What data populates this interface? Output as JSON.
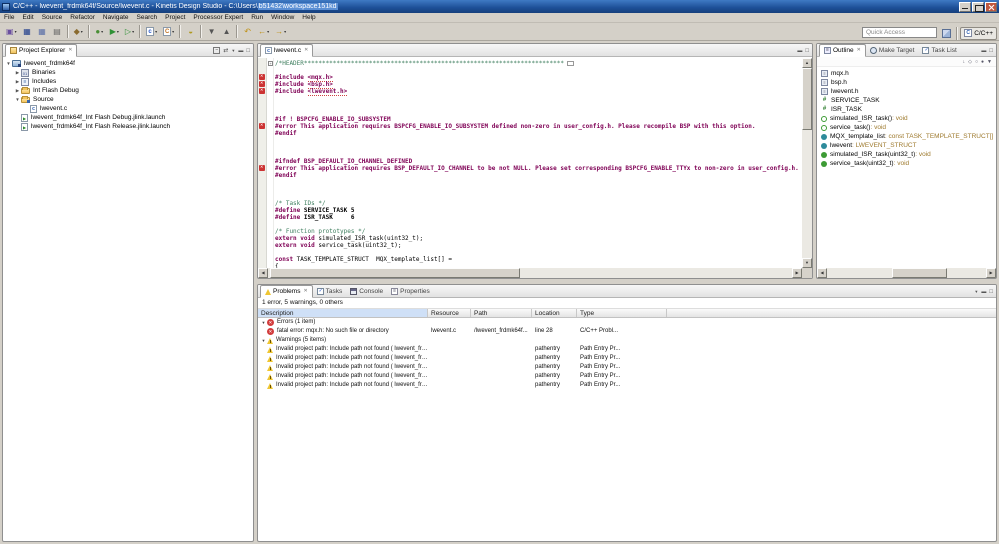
{
  "window": {
    "title_prefix": "C/C++ - lwevent_frdmk64f/Source/lwevent.c - Kinetis Design Studio - C:\\Users\\",
    "title_highlight": "b51432\\workspace151kd"
  },
  "menu": {
    "items": [
      "File",
      "Edit",
      "Source",
      "Refactor",
      "Navigate",
      "Search",
      "Project",
      "Processor Expert",
      "Run",
      "Window",
      "Help"
    ]
  },
  "toolbar": {
    "quick_access_placeholder": "Quick Access",
    "perspective_label": "C/C++",
    "buttons": [
      {
        "name": "new-wizard-button",
        "glyph": "▣",
        "color": "#6a4fa0",
        "dd": true
      },
      {
        "name": "save-button",
        "glyph": "▦",
        "color": "#1f3d8c"
      },
      {
        "name": "save-all-button",
        "glyph": "▦",
        "color": "#5a6fa8"
      },
      {
        "name": "print-button",
        "glyph": "▤",
        "color": "#666666"
      },
      {
        "sep": true
      },
      {
        "name": "build-button",
        "glyph": "◆",
        "color": "#8a6b2f",
        "dd": true
      },
      {
        "sep": true
      },
      {
        "name": "debug-button",
        "glyph": "●",
        "color": "#4a8f35",
        "dd": true
      },
      {
        "name": "run-button",
        "glyph": "▶",
        "color": "#2f9135",
        "dd": true
      },
      {
        "name": "external-tools-button",
        "glyph": "▷",
        "color": "#2f9135",
        "dd": true
      },
      {
        "sep": true
      },
      {
        "name": "new-c-file-button",
        "glyph": "c",
        "color": "#2255cc",
        "boxed": true,
        "dd": true
      },
      {
        "name": "new-cpp-class-button",
        "glyph": "C",
        "color": "#c07020",
        "boxed": true,
        "dd": true
      },
      {
        "sep": true
      },
      {
        "name": "search-button",
        "glyph": "◒",
        "color": "#b09a20"
      },
      {
        "sep": true
      },
      {
        "name": "next-annotation-button",
        "glyph": "▼",
        "color": "#555555"
      },
      {
        "name": "previous-annotation-button",
        "glyph": "▲",
        "color": "#555555"
      },
      {
        "sep": true
      },
      {
        "name": "last-edit-location-button",
        "glyph": "↶",
        "color": "#c09010"
      },
      {
        "name": "back-button",
        "glyph": "←",
        "color": "#c09010",
        "dd": true
      },
      {
        "name": "forward-button",
        "glyph": "→",
        "color": "#c09010",
        "dd": true
      }
    ]
  },
  "project_explorer": {
    "tab_label": "Project Explorer",
    "tree": [
      {
        "label": "lwevent_frdmk64f",
        "icon": "project",
        "depth": 0,
        "arrow": "open"
      },
      {
        "label": "Binaries",
        "icon": "binaries",
        "depth": 1,
        "arrow": "closed"
      },
      {
        "label": "Includes",
        "icon": "includes",
        "depth": 1,
        "arrow": "closed"
      },
      {
        "label": "Int Flash Debug",
        "icon": "folder",
        "depth": 1,
        "arrow": "closed"
      },
      {
        "label": "Source",
        "icon": "src-folder",
        "depth": 1,
        "arrow": "open"
      },
      {
        "label": "lwevent.c",
        "icon": "c-file",
        "depth": 2,
        "arrow": null
      },
      {
        "label": "lwevent_frdmk64f_Int Flash Debug.jlink.launch",
        "icon": "launch",
        "depth": 1,
        "arrow": null
      },
      {
        "label": "lwevent_frdmk64f_Int Flash Release.jlink.launch",
        "icon": "launch",
        "depth": 1,
        "arrow": null
      }
    ]
  },
  "editor": {
    "tab_label": "lwevent.c",
    "lines": [
      {
        "fold": true,
        "s": [
          [
            "cm",
            "/*HEADER************************************************************************"
          ],
          [
            "fb",
            ""
          ]
        ]
      },
      {
        "s": []
      },
      {
        "m": 1,
        "s": [
          [
            "pp",
            "#include "
          ],
          [
            "inc",
            "<mqx.h>"
          ]
        ]
      },
      {
        "m": 1,
        "s": [
          [
            "pp",
            "#include "
          ],
          [
            "inc",
            "<bsp.h>"
          ]
        ]
      },
      {
        "m": 1,
        "s": [
          [
            "pp",
            "#include "
          ],
          [
            "inc",
            "<lwevent.h>"
          ]
        ]
      },
      {
        "s": []
      },
      {
        "s": []
      },
      {
        "s": []
      },
      {
        "s": [
          [
            "pp",
            "#if ! BSPCFG_ENABLE_IO_SUBSYSTEM"
          ]
        ]
      },
      {
        "m": 1,
        "s": [
          [
            "pp",
            "#error This application requires BSPCFG_ENABLE_IO_SUBSYSTEM defined non-zero in user_config.h. Please recompile BSP with this option."
          ]
        ]
      },
      {
        "s": [
          [
            "pp",
            "#endif"
          ]
        ]
      },
      {
        "s": []
      },
      {
        "s": []
      },
      {
        "s": []
      },
      {
        "s": [
          [
            "pp",
            "#ifndef BSP_DEFAULT_IO_CHANNEL_DEFINED"
          ]
        ]
      },
      {
        "m": 1,
        "s": [
          [
            "pp",
            "#error This application requires BSP_DEFAULT_IO_CHANNEL to be not NULL. Please set corresponding BSPCFG_ENABLE_TTYx to non-zero in user_config.h."
          ]
        ]
      },
      {
        "s": [
          [
            "pp",
            "#endif"
          ]
        ]
      },
      {
        "s": []
      },
      {
        "s": []
      },
      {
        "s": []
      },
      {
        "s": [
          [
            "cm",
            "/* Task IDs */"
          ]
        ]
      },
      {
        "s": [
          [
            "pp",
            "#define "
          ],
          [
            "plb",
            "SERVICE_TASK 5"
          ]
        ]
      },
      {
        "s": [
          [
            "pp",
            "#define "
          ],
          [
            "plb",
            "ISR_TASK     6"
          ]
        ]
      },
      {
        "s": []
      },
      {
        "s": [
          [
            "cm",
            "/* Function prototypes */"
          ]
        ]
      },
      {
        "s": [
          [
            "kw",
            "extern void"
          ],
          [
            "pl",
            " simulated_ISR_task(uint32_t);"
          ]
        ]
      },
      {
        "s": [
          [
            "kw",
            "extern void"
          ],
          [
            "pl",
            " service_task(uint32_t);"
          ]
        ]
      },
      {
        "s": []
      },
      {
        "s": [
          [
            "kw",
            "const"
          ],
          [
            "pl",
            " TASK_TEMPLATE_STRUCT  MQX_template_list[] ="
          ]
        ]
      },
      {
        "s": [
          [
            "pl",
            "{"
          ]
        ]
      }
    ]
  },
  "outline": {
    "tabs": [
      "Outline",
      "Make Target",
      "Task List"
    ],
    "items": [
      {
        "icon": "include",
        "label": "mqx.h",
        "suffix": ""
      },
      {
        "icon": "include",
        "label": "bsp.h",
        "suffix": ""
      },
      {
        "icon": "include",
        "label": "lwevent.h",
        "suffix": ""
      },
      {
        "icon": "macro",
        "label": "SERVICE_TASK",
        "suffix": ""
      },
      {
        "icon": "macro",
        "label": "ISR_TASK",
        "suffix": ""
      },
      {
        "icon": "func-decl",
        "label": "simulated_ISR_task()",
        "suffix": " : void"
      },
      {
        "icon": "func-decl",
        "label": "service_task()",
        "suffix": " : void"
      },
      {
        "icon": "variable",
        "label": "MQX_template_list",
        "suffix": " : const TASK_TEMPLATE_STRUCT[]"
      },
      {
        "icon": "variable",
        "label": "lwevent",
        "suffix": " : LWEVENT_STRUCT"
      },
      {
        "icon": "func-def",
        "label": "simulated_ISR_task(uint32_t)",
        "suffix": " : void"
      },
      {
        "icon": "func-def",
        "label": "service_task(uint32_t)",
        "suffix": " : void"
      }
    ]
  },
  "problems": {
    "tabs": [
      "Problems",
      "Tasks",
      "Console",
      "Properties"
    ],
    "tab_icons": [
      "problems",
      "tasks",
      "console",
      "properties"
    ],
    "summary": "1 error, 5 warnings, 0 others",
    "columns": [
      "Description",
      "Resource",
      "Path",
      "Location",
      "Type"
    ],
    "rows": [
      {
        "kind": "group",
        "icon": "error",
        "desc": "Errors (1 item)",
        "resource": "",
        "path": "",
        "location": "",
        "type": ""
      },
      {
        "kind": "item",
        "icon": "error",
        "desc": "fatal error: mqx.h: No such file or directory",
        "resource": "lwevent.c",
        "path": "/lwevent_frdmk64f...",
        "location": "line 28",
        "type": "C/C++ Probl..."
      },
      {
        "kind": "group",
        "icon": "warning",
        "desc": "Warnings (5 items)",
        "resource": "",
        "path": "",
        "location": "",
        "type": ""
      },
      {
        "kind": "item",
        "icon": "warning",
        "desc": "Invalid project path: Include path not found ( lwevent_frdm...",
        "resource": "",
        "path": "",
        "location": "pathentry",
        "type": "Path Entry Pr..."
      },
      {
        "kind": "item",
        "icon": "warning",
        "desc": "Invalid project path: Include path not found ( lwevent_frdm...",
        "resource": "",
        "path": "",
        "location": "pathentry",
        "type": "Path Entry Pr..."
      },
      {
        "kind": "item",
        "icon": "warning",
        "desc": "Invalid project path: Include path not found ( lwevent_frdm...",
        "resource": "",
        "path": "",
        "location": "pathentry",
        "type": "Path Entry Pr..."
      },
      {
        "kind": "item",
        "icon": "warning",
        "desc": "Invalid project path: Include path not found ( lwevent_frdm...",
        "resource": "",
        "path": "",
        "location": "pathentry",
        "type": "Path Entry Pr..."
      },
      {
        "kind": "item",
        "icon": "warning",
        "desc": "Invalid project path: Include path not found ( lwevent_frdm...",
        "resource": "",
        "path": "",
        "location": "pathentry",
        "type": "Path Entry Pr..."
      }
    ]
  }
}
